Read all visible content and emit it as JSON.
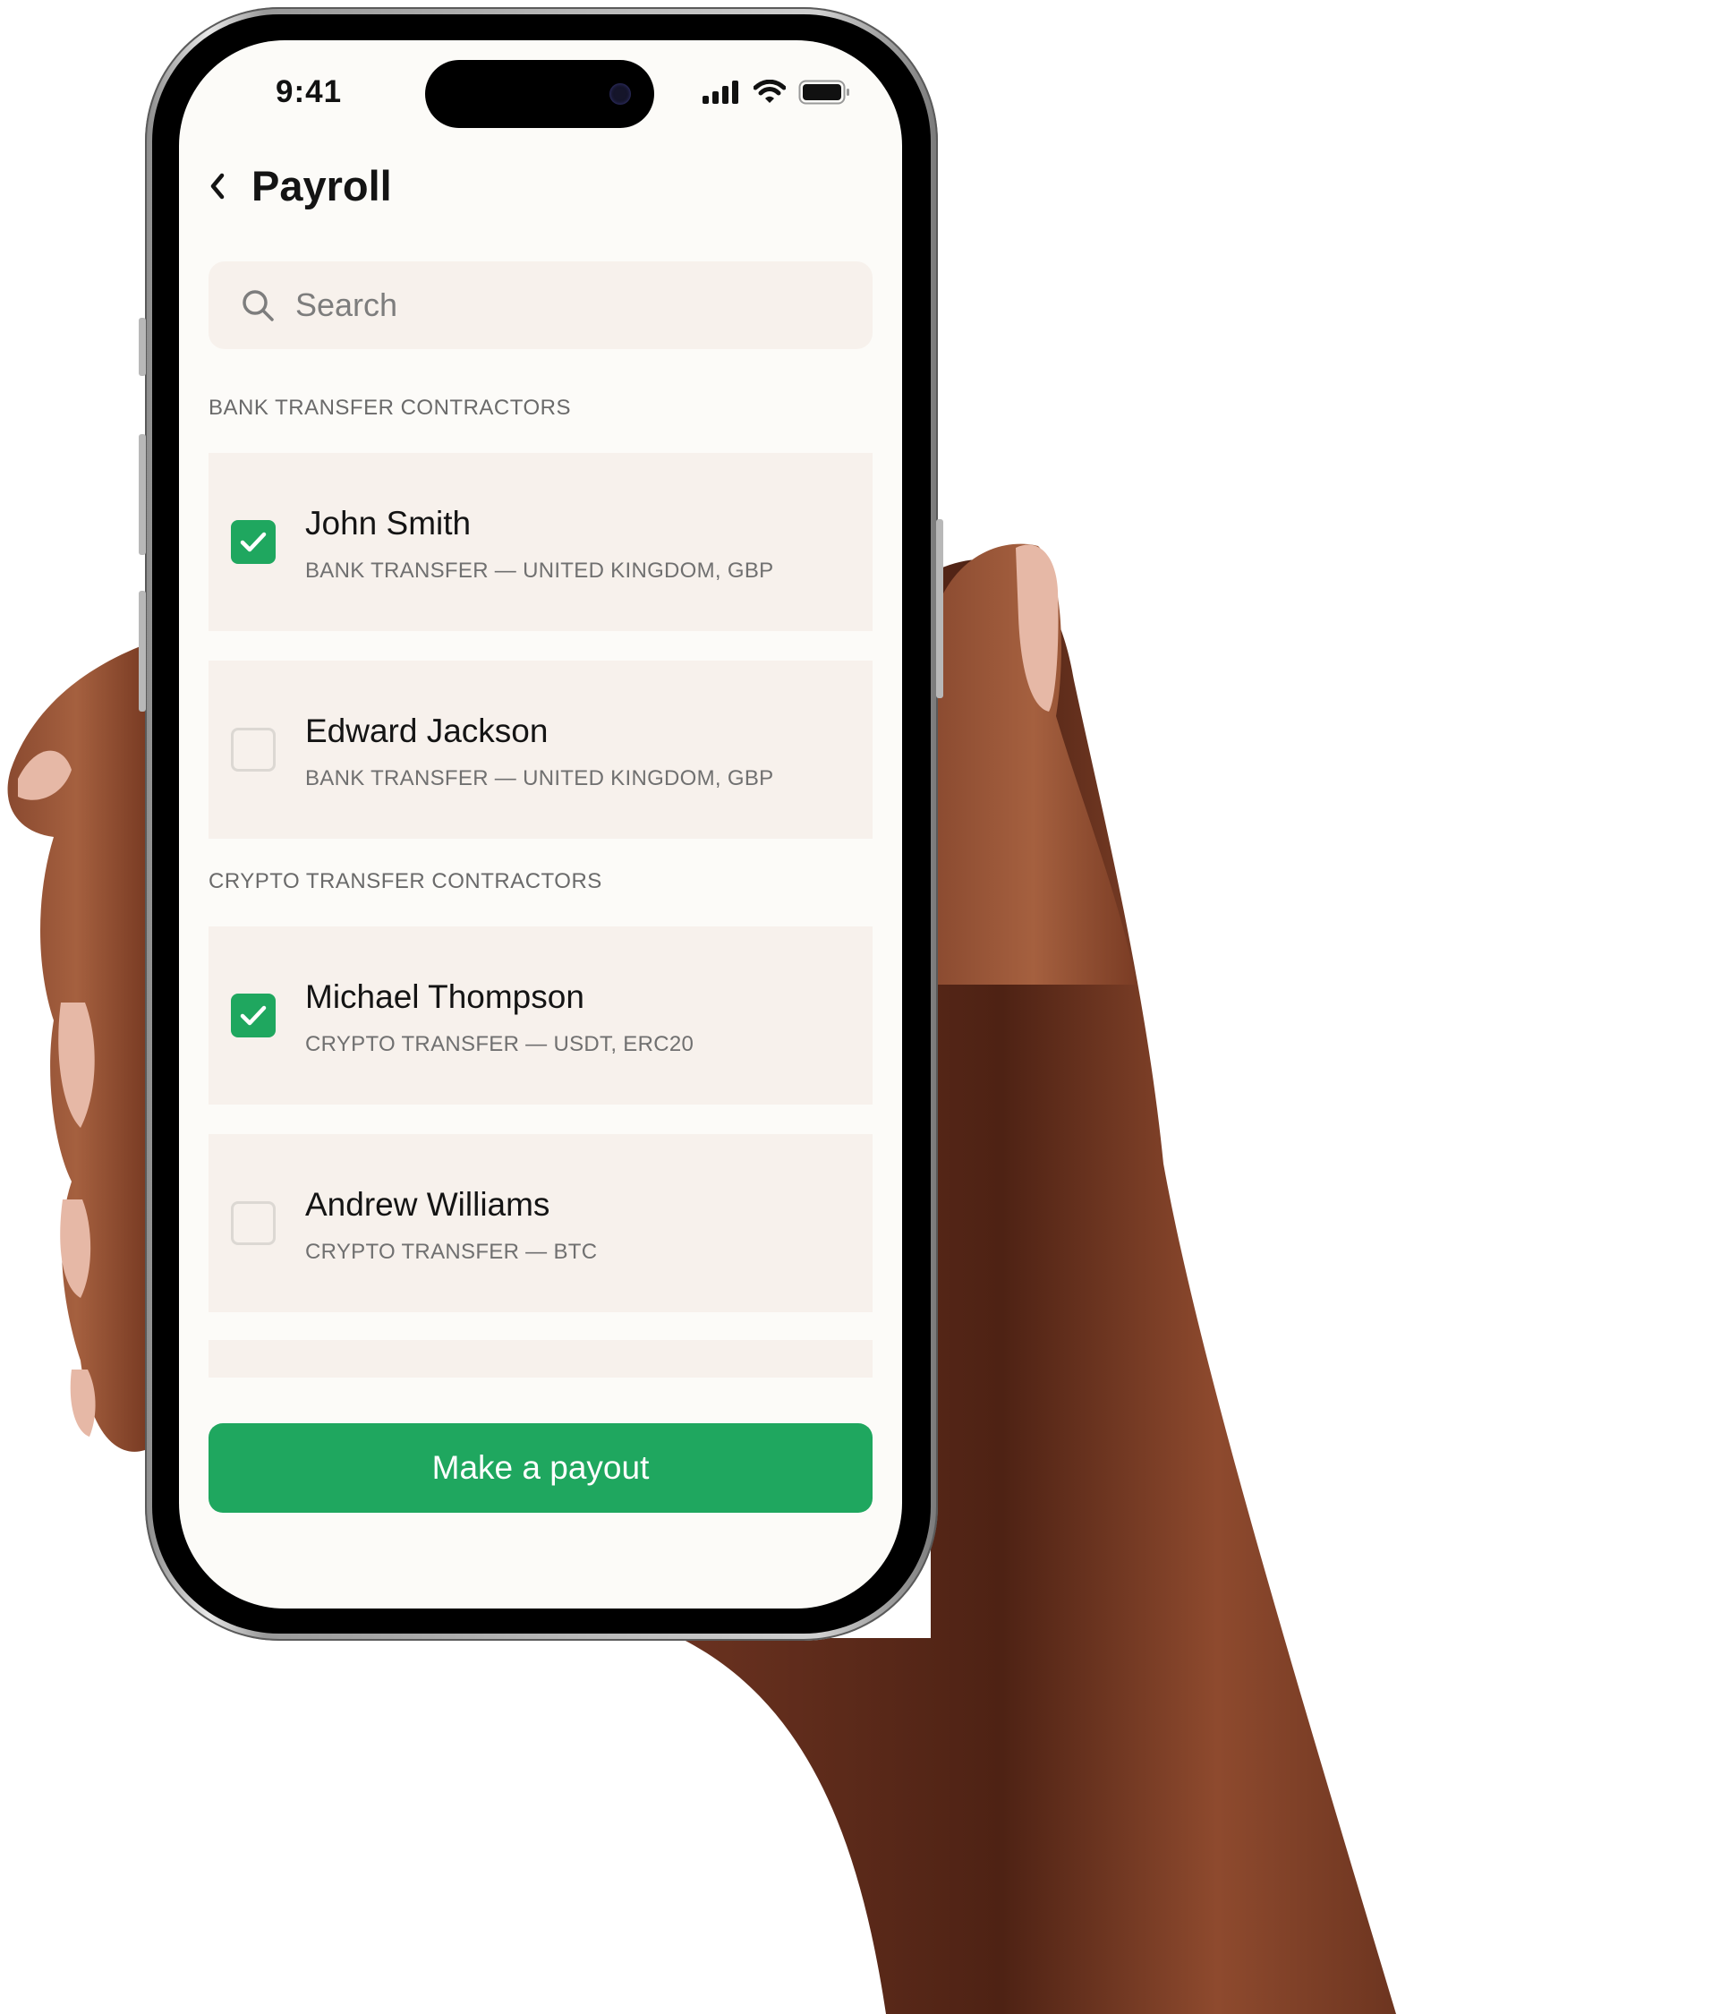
{
  "status_bar": {
    "time": "9:41",
    "icons": [
      "signal-icon",
      "wifi-icon",
      "battery-icon"
    ]
  },
  "header": {
    "back_icon": "chevron-left-icon",
    "title": "Payroll"
  },
  "search": {
    "icon": "search-icon",
    "placeholder": "Search",
    "value": ""
  },
  "sections": [
    {
      "label": "BANK TRANSFER CONTRACTORS",
      "items": [
        {
          "name": "John Smith",
          "detail": "BANK TRANSFER — UNITED KINGDOM, GBP",
          "checked": true
        },
        {
          "name": "Edward Jackson",
          "detail": "BANK TRANSFER — UNITED KINGDOM, GBP",
          "checked": false
        }
      ]
    },
    {
      "label": "CRYPTO TRANSFER CONTRACTORS",
      "items": [
        {
          "name": "Michael Thompson",
          "detail": "CRYPTO TRANSFER — USDT, ERC20",
          "checked": true
        },
        {
          "name": "Andrew Williams",
          "detail": "CRYPTO TRANSFER — BTC",
          "checked": false
        }
      ]
    }
  ],
  "primary_action": {
    "label": "Make a payout"
  },
  "colors": {
    "accent": "#1fa75f",
    "card_background": "#f7f1ec",
    "screen_background": "#fcfbf8",
    "text_primary": "#141414",
    "text_secondary": "#707070"
  }
}
